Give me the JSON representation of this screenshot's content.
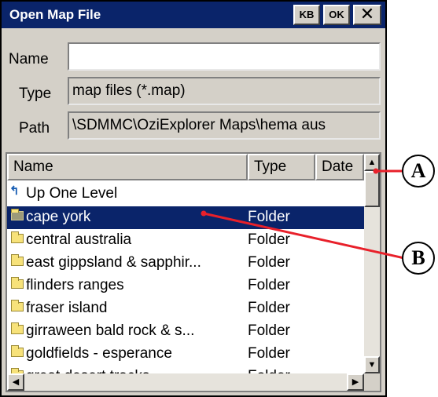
{
  "window": {
    "title": "Open Map File",
    "buttons": {
      "kb": "KB",
      "ok": "OK",
      "close": "✕"
    }
  },
  "form": {
    "name_label": "Name",
    "name_value": "",
    "type_label": "Type",
    "type_value": "map files (*.map)",
    "path_label": "Path",
    "path_value": "\\SDMMC\\OziExplorer Maps\\hema aus"
  },
  "list": {
    "columns": [
      "Name",
      "Type",
      "Date"
    ],
    "up_label": "Up One Level",
    "items": [
      {
        "name": "cape york",
        "type": "Folder",
        "selected": true
      },
      {
        "name": "central australia",
        "type": "Folder"
      },
      {
        "name": "east gippsland & sapphir...",
        "type": "Folder"
      },
      {
        "name": "flinders ranges",
        "type": "Folder"
      },
      {
        "name": "fraser island",
        "type": "Folder"
      },
      {
        "name": "girraween bald rock & s...",
        "type": "Folder"
      },
      {
        "name": "goldfields - esperance",
        "type": "Folder"
      },
      {
        "name": "great desert tracks",
        "type": "Folder"
      }
    ]
  },
  "callouts": {
    "a": "A",
    "b": "B",
    "color": "#e8202a"
  },
  "colors": {
    "titlebar": "#0a246a",
    "selection": "#0a246a",
    "dialog": "#d4d0c8"
  }
}
